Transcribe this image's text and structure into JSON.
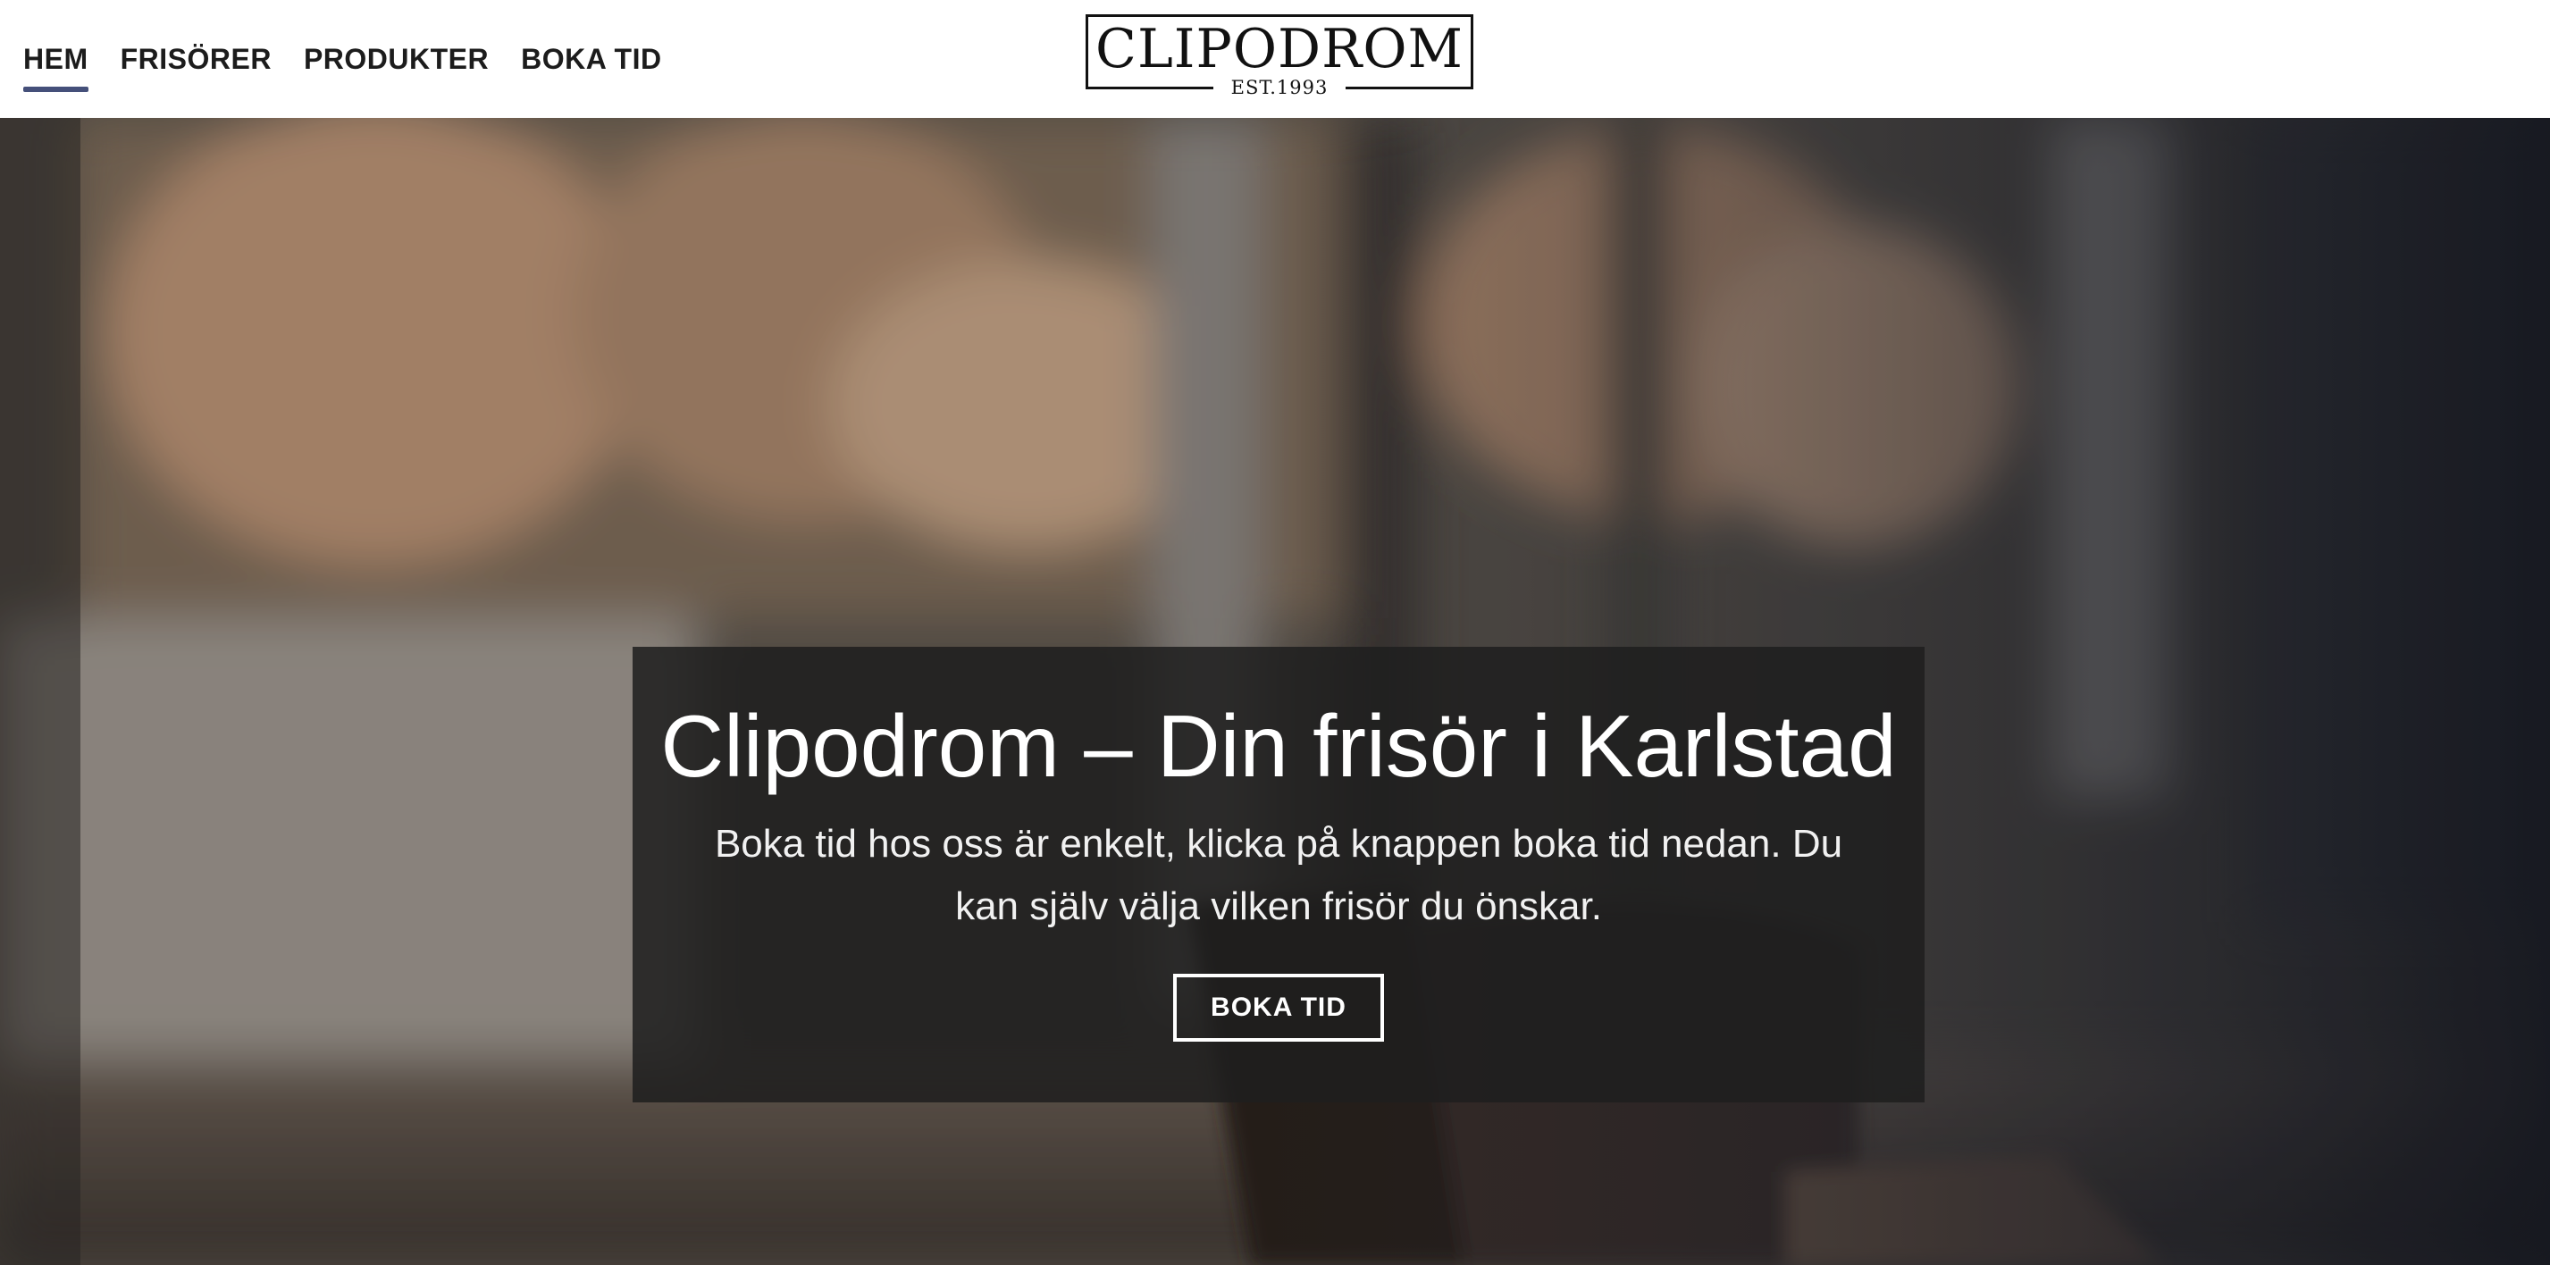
{
  "header": {
    "nav": [
      {
        "label": "HEM",
        "active": true
      },
      {
        "label": "FRISÖRER",
        "active": false
      },
      {
        "label": "PRODUKTER",
        "active": false
      },
      {
        "label": "BOKA TID",
        "active": false
      }
    ],
    "logo": {
      "name": "CLIPODROM",
      "established": "EST.1993"
    }
  },
  "hero": {
    "title": "Clipodrom – Din frisör i Karlstad",
    "text": "Boka tid hos oss är enkelt, klicka på knappen boka tid nedan. Du kan själv välja vilken frisör du önskar.",
    "cta_label": "BOKA TID",
    "background_image": "blurred-salon-interior-photo"
  },
  "colors": {
    "nav_active_underline": "#45507a",
    "overlay": "#1e1e1e",
    "text_dark": "#1c1c1c"
  }
}
